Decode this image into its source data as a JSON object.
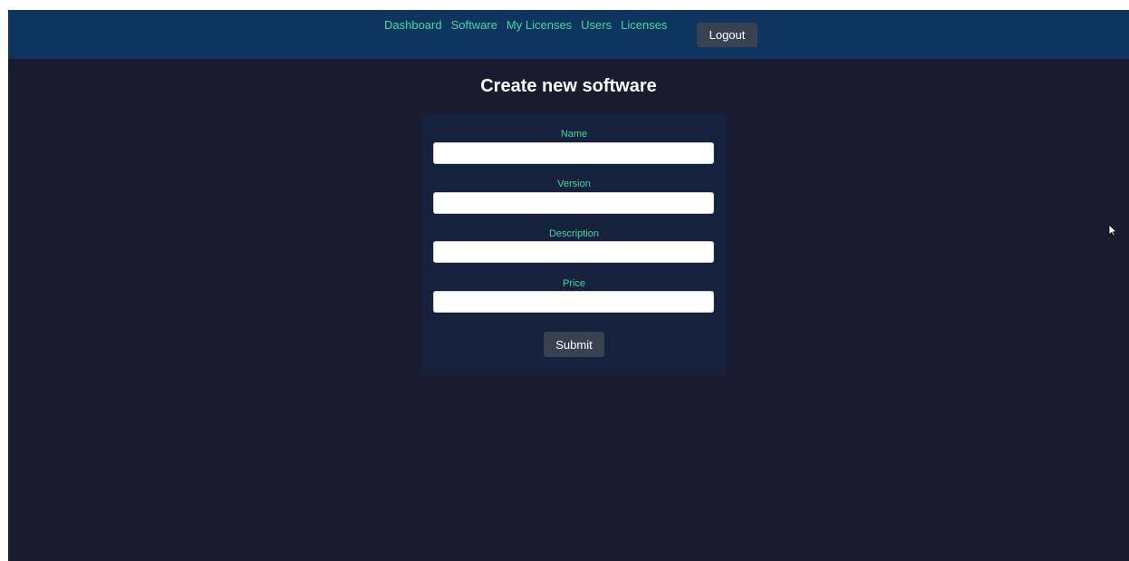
{
  "nav": {
    "links": [
      {
        "label": "Dashboard"
      },
      {
        "label": "Software"
      },
      {
        "label": "My Licenses"
      },
      {
        "label": "Users"
      },
      {
        "label": "Licenses"
      }
    ],
    "logout_label": "Logout"
  },
  "page": {
    "title": "Create new software"
  },
  "form": {
    "fields": [
      {
        "label": "Name",
        "value": ""
      },
      {
        "label": "Version",
        "value": ""
      },
      {
        "label": "Description",
        "value": ""
      },
      {
        "label": "Price",
        "value": ""
      }
    ],
    "submit_label": "Submit"
  },
  "colors": {
    "background": "#1a1b2e",
    "navbar": "#0f3460",
    "card": "#16213e",
    "accent_text": "#3fd8a0",
    "button": "#3a4150"
  },
  "icons": {
    "cursor": "mouse-pointer-icon"
  }
}
